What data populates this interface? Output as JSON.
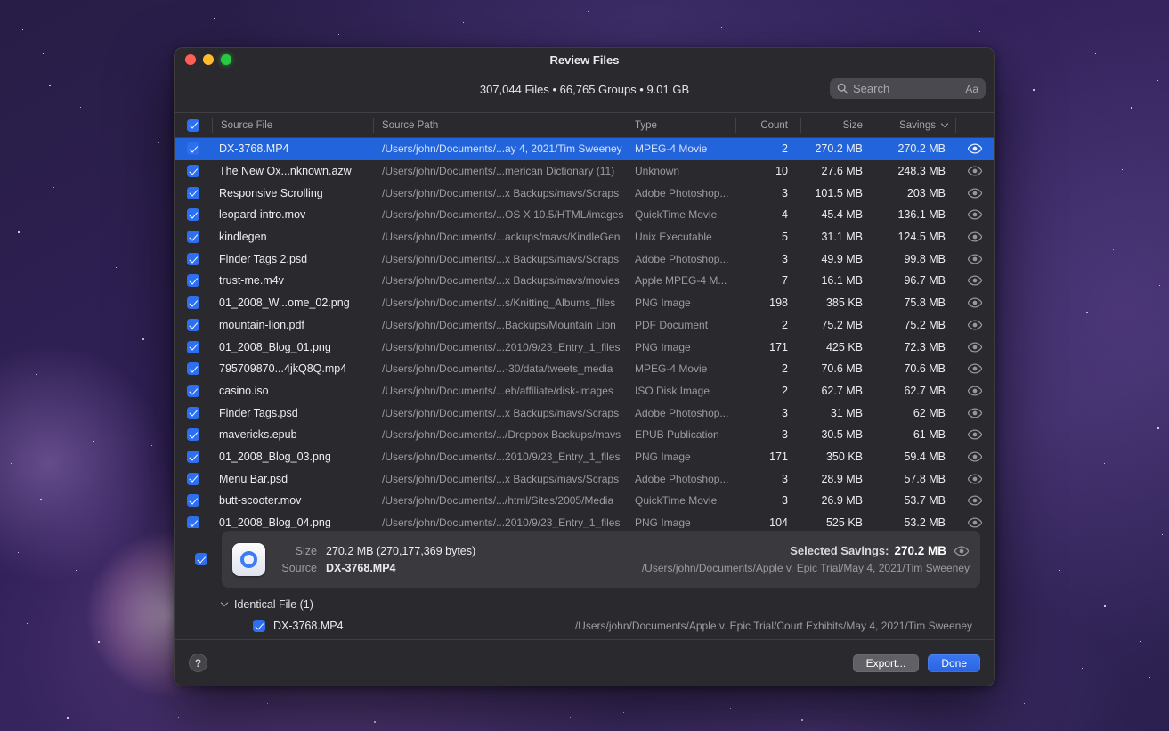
{
  "window": {
    "title": "Review Files",
    "summary": "307,044 Files  •  66,765 Groups  •  9.01 GB"
  },
  "search": {
    "placeholder": "Search",
    "case_label": "Aa"
  },
  "table": {
    "columns": {
      "file": "Source File",
      "path": "Source Path",
      "type": "Type",
      "count": "Count",
      "size": "Size",
      "savings": "Savings"
    },
    "rows": [
      {
        "selected": true,
        "file": "DX-3768.MP4",
        "path": "/Users/john/Documents/...ay 4, 2021/Tim Sweeney",
        "type": "MPEG-4 Movie",
        "count": "2",
        "size": "270.2 MB",
        "savings": "270.2 MB"
      },
      {
        "selected": false,
        "file": "The New Ox...nknown.azw",
        "path": "/Users/john/Documents/...merican Dictionary (11)",
        "type": "Unknown",
        "count": "10",
        "size": "27.6 MB",
        "savings": "248.3 MB"
      },
      {
        "selected": false,
        "file": "Responsive Scrolling",
        "path": "/Users/john/Documents/...x Backups/mavs/Scraps",
        "type": "Adobe Photoshop...",
        "count": "3",
        "size": "101.5 MB",
        "savings": "203 MB"
      },
      {
        "selected": false,
        "file": "leopard-intro.mov",
        "path": "/Users/john/Documents/...OS X 10.5/HTML/images",
        "type": "QuickTime Movie",
        "count": "4",
        "size": "45.4 MB",
        "savings": "136.1 MB"
      },
      {
        "selected": false,
        "file": "kindlegen",
        "path": "/Users/john/Documents/...ackups/mavs/KindleGen",
        "type": "Unix Executable",
        "count": "5",
        "size": "31.1 MB",
        "savings": "124.5 MB"
      },
      {
        "selected": false,
        "file": "Finder Tags 2.psd",
        "path": "/Users/john/Documents/...x Backups/mavs/Scraps",
        "type": "Adobe Photoshop...",
        "count": "3",
        "size": "49.9 MB",
        "savings": "99.8 MB"
      },
      {
        "selected": false,
        "file": "trust-me.m4v",
        "path": "/Users/john/Documents/...x Backups/mavs/movies",
        "type": "Apple MPEG-4 M...",
        "count": "7",
        "size": "16.1 MB",
        "savings": "96.7 MB"
      },
      {
        "selected": false,
        "file": "01_2008_W...ome_02.png",
        "path": "/Users/john/Documents/...s/Knitting_Albums_files",
        "type": "PNG Image",
        "count": "198",
        "size": "385 KB",
        "savings": "75.8 MB"
      },
      {
        "selected": false,
        "file": "mountain-lion.pdf",
        "path": "/Users/john/Documents/...Backups/Mountain Lion",
        "type": "PDF Document",
        "count": "2",
        "size": "75.2 MB",
        "savings": "75.2 MB"
      },
      {
        "selected": false,
        "file": "01_2008_Blog_01.png",
        "path": "/Users/john/Documents/...2010/9/23_Entry_1_files",
        "type": "PNG Image",
        "count": "171",
        "size": "425 KB",
        "savings": "72.3 MB"
      },
      {
        "selected": false,
        "file": "795709870...4jkQ8Q.mp4",
        "path": "/Users/john/Documents/...-30/data/tweets_media",
        "type": "MPEG-4 Movie",
        "count": "2",
        "size": "70.6 MB",
        "savings": "70.6 MB"
      },
      {
        "selected": false,
        "file": "casino.iso",
        "path": "/Users/john/Documents/...eb/affiliate/disk-images",
        "type": "ISO Disk Image",
        "count": "2",
        "size": "62.7 MB",
        "savings": "62.7 MB"
      },
      {
        "selected": false,
        "file": "Finder Tags.psd",
        "path": "/Users/john/Documents/...x Backups/mavs/Scraps",
        "type": "Adobe Photoshop...",
        "count": "3",
        "size": "31 MB",
        "savings": "62 MB"
      },
      {
        "selected": false,
        "file": "mavericks.epub",
        "path": "/Users/john/Documents/.../Dropbox Backups/mavs",
        "type": "EPUB Publication",
        "count": "3",
        "size": "30.5 MB",
        "savings": "61 MB"
      },
      {
        "selected": false,
        "file": "01_2008_Blog_03.png",
        "path": "/Users/john/Documents/...2010/9/23_Entry_1_files",
        "type": "PNG Image",
        "count": "171",
        "size": "350 KB",
        "savings": "59.4 MB"
      },
      {
        "selected": false,
        "file": "Menu Bar.psd",
        "path": "/Users/john/Documents/...x Backups/mavs/Scraps",
        "type": "Adobe Photoshop...",
        "count": "3",
        "size": "28.9 MB",
        "savings": "57.8 MB"
      },
      {
        "selected": false,
        "file": "butt-scooter.mov",
        "path": "/Users/john/Documents/.../html/Sites/2005/Media",
        "type": "QuickTime Movie",
        "count": "3",
        "size": "26.9 MB",
        "savings": "53.7 MB"
      },
      {
        "selected": false,
        "file": "01_2008_Blog_04.png",
        "path": "/Users/john/Documents/...2010/9/23_Entry_1_files",
        "type": "PNG Image",
        "count": "104",
        "size": "525 KB",
        "savings": "53.2 MB"
      }
    ]
  },
  "detail": {
    "size_label": "Size",
    "size_value": "270.2 MB (270,177,369 bytes)",
    "selected_savings_label": "Selected Savings:",
    "selected_savings_value": "270.2 MB",
    "source_label": "Source",
    "source_value": "DX-3768.MP4",
    "source_path": "/Users/john/Documents/Apple v. Epic Trial/May 4, 2021/Tim Sweeney",
    "identical_label": "Identical File (1)",
    "identical_file": "DX-3768.MP4",
    "identical_path": "/Users/john/Documents/Apple v. Epic Trial/Court Exhibits/May 4, 2021/Tim Sweeney"
  },
  "footer": {
    "help_label": "?",
    "export_label": "Export...",
    "done_label": "Done"
  },
  "colors": {
    "accent": "#2d6ff0",
    "selection": "#2264dc",
    "done_button": "#2e6be5"
  }
}
